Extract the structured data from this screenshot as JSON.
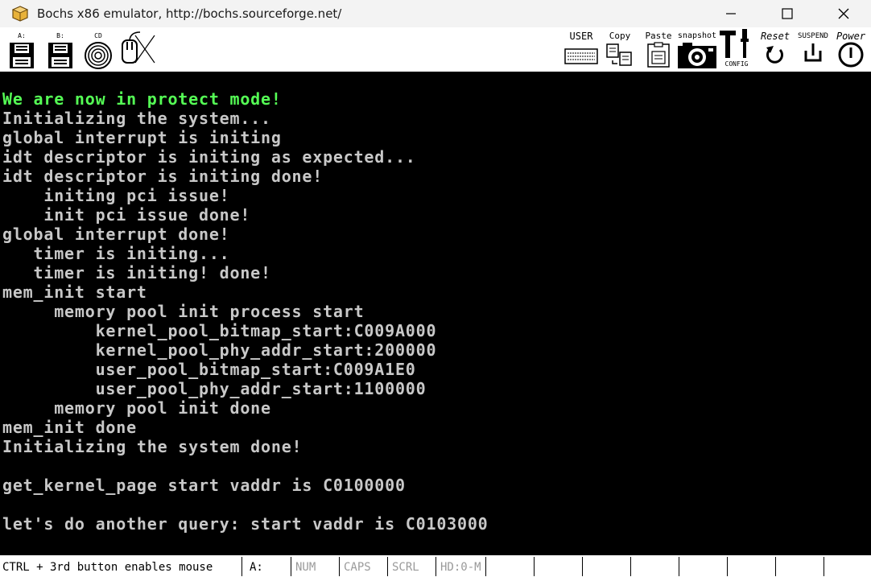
{
  "window": {
    "title": "Bochs x86 emulator, http://bochs.sourceforge.net/",
    "icon": "bochs-icon",
    "controls": [
      "minimize-icon",
      "maximize-icon",
      "close-icon"
    ]
  },
  "toolbar": {
    "floppy_a_label": "A:",
    "floppy_b_label": "B:",
    "cdrom_label": "CD",
    "user_label": "USER",
    "copy_label": "Copy",
    "paste_label": "Paste",
    "snapshot_label": "snapshot",
    "config_label": "CONFIG",
    "reset_label": "Reset",
    "suspend_label": "SUSPEND",
    "power_label": "Power"
  },
  "screen": {
    "lines": [
      "We are now in protect mode!",
      "Initializing the system...",
      "global interrupt is initing",
      "idt descriptor is initing as expected...",
      "idt descriptor is initing done!",
      "    initing pci issue!",
      "    init pci issue done!",
      "global interrupt done!",
      "   timer is initing...",
      "   timer is initing! done!",
      "mem_init start",
      "     memory pool init process start",
      "         kernel_pool_bitmap_start:C009A000",
      "         kernel_pool_phy_addr_start:200000",
      "         user_pool_bitmap_start:C009A1E0",
      "         user_pool_phy_addr_start:1100000",
      "     memory pool init done",
      "mem_init done",
      "Initializing the system done!",
      "",
      "get_kernel_page start vaddr is C0100000",
      "",
      "let's do another query: start vaddr is C0103000"
    ],
    "highlight_color": "#55ff55",
    "text_color": "#c8c8c8",
    "background": "#000000"
  },
  "statusbar": {
    "mouse_hint": "CTRL + 3rd button enables mouse",
    "floppy": "A:",
    "num": "NUM",
    "caps": "CAPS",
    "scrl": "SCRL",
    "hd": "HD:0-M"
  }
}
